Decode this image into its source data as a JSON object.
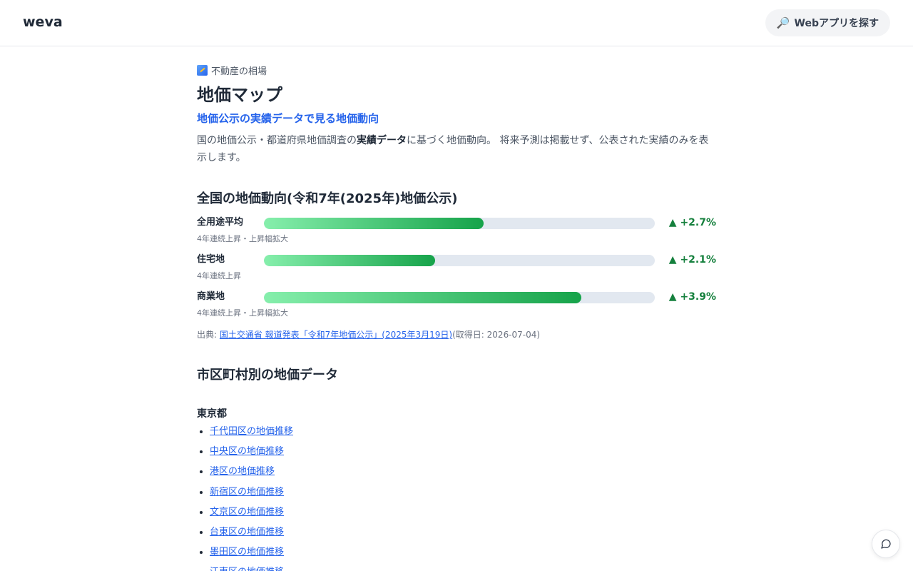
{
  "header": {
    "logo": "weva",
    "find_apps_label": "Webアプリを探す"
  },
  "breadcrumb": {
    "label": "不動産の相場"
  },
  "page": {
    "title": "地価マップ",
    "subtitle": "地価公示の実績データで見る地価動向",
    "desc_part1": "国の地価公示・都道府県地価調査の",
    "desc_bold": "実績データ",
    "desc_part2": "に基づく地価動向。 将来予測は掲載せず、公表された実績のみを表示します。"
  },
  "national": {
    "heading": "全国の地価動向(令和7年(2025年)地価公示)",
    "rows": [
      {
        "label": "全用途平均",
        "value": "▲ +2.7%",
        "percent": 2.7,
        "note": "4年連続上昇・上昇幅拡大"
      },
      {
        "label": "住宅地",
        "value": "▲ +2.1%",
        "percent": 2.1,
        "note": "4年連続上昇"
      },
      {
        "label": "商業地",
        "value": "▲ +3.9%",
        "percent": 3.9,
        "note": "4年連続上昇・上昇幅拡大"
      }
    ],
    "scale_max_percent": 4.8,
    "source_prefix": "出典: ",
    "source_link": "国土交通省 報道発表「令和7年地価公示」(2025年3月19日)",
    "source_suffix": "(取得日: 2026-07-04)"
  },
  "municipal": {
    "heading": "市区町村別の地価データ",
    "prefecture": "東京都",
    "wards": [
      "千代田区の地価推移",
      "中央区の地価推移",
      "港区の地価推移",
      "新宿区の地価推移",
      "文京区の地価推移",
      "台東区の地価推移",
      "墨田区の地価推移",
      "江東区の地価推移"
    ]
  },
  "colors": {
    "accent": "#2563eb",
    "positive": "#15803d",
    "bar_start": "#86efac",
    "bar_end": "#16a34a",
    "track": "#e2e8f0"
  },
  "icons": {
    "find_apps": "magnifier-icon",
    "breadcrumb": "chart-up-icon",
    "chat": "chat-bubble-icon"
  }
}
